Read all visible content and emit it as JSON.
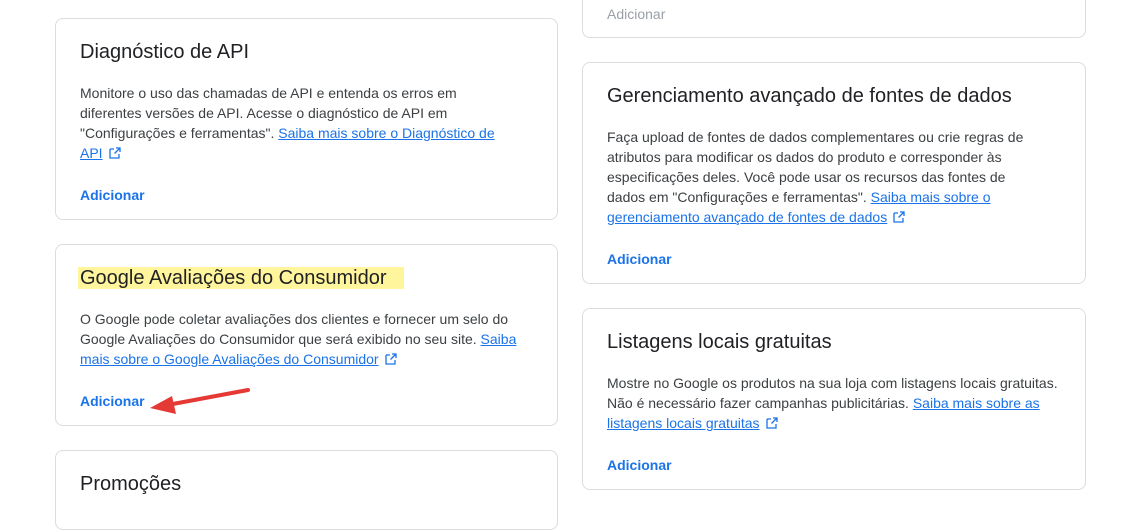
{
  "left": {
    "api": {
      "title": "Diagnóstico de API",
      "body": "Monitore o uso das chamadas de API e entenda os erros em diferentes versões de API. Acesse o diagnóstico de API em \"Configurações e ferramentas\". ",
      "link": "Saiba mais sobre o Diagnóstico de API",
      "action": "Adicionar"
    },
    "reviews": {
      "title": "Google Avaliações do Consumidor",
      "body": "O Google pode coletar avaliações dos clientes e fornecer um selo do Google Avaliações do Consumidor que será exibido no seu site. ",
      "link": "Saiba mais sobre o Google Avaliações do Consumidor",
      "action": "Adicionar"
    },
    "promos": {
      "title": "Promoções"
    }
  },
  "right": {
    "top_partial": {
      "action": "Adicionar"
    },
    "feeds": {
      "title": "Gerenciamento avançado de fontes de dados",
      "body": "Faça upload de fontes de dados complementares ou crie regras de atributos para modificar os dados do produto e corresponder às especificações deles. Você pode usar os recursos das fontes de dados em \"Configurações e ferramentas\". ",
      "link": "Saiba mais sobre o gerenciamento avançado de fontes de dados",
      "action": "Adicionar"
    },
    "local": {
      "title": "Listagens locais gratuitas",
      "body": "Mostre no Google os produtos na sua loja com listagens locais gratuitas. Não é necessário fazer campanhas publicitárias. ",
      "link": "Saiba mais sobre as listagens locais gratuitas",
      "action": "Adicionar"
    }
  },
  "icons": {
    "external_link": "open-in-new-icon",
    "annotation": "red-arrow-annotation"
  },
  "colors": {
    "link": "#1a73e8",
    "highlight": "#fff59d",
    "arrow": "#e53935"
  }
}
